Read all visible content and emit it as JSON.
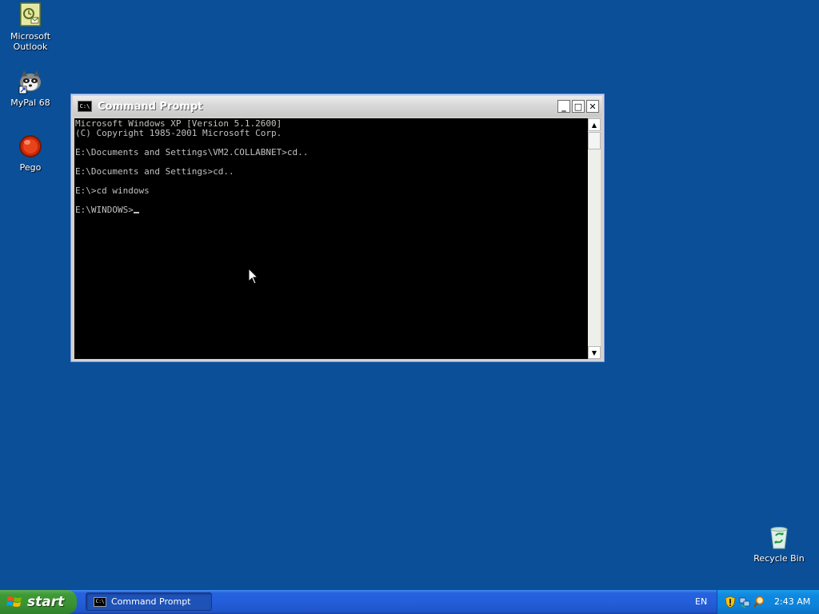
{
  "desktop": {
    "background_color": "#0b4f98",
    "icons": [
      {
        "label_line1": "Microsoft",
        "label_line2": "Outlook",
        "icon": "outlook-icon"
      },
      {
        "label": "MyPal 68",
        "icon": "mypal-icon"
      },
      {
        "label": "Pego",
        "icon": "pego-icon"
      },
      {
        "label": "Recycle Bin",
        "icon": "recycle-bin-icon"
      }
    ]
  },
  "window": {
    "title": "Command Prompt",
    "icon_text": "C:\\",
    "buttons": {
      "minimize": "_",
      "maximize": "□",
      "close": "✕"
    },
    "console_lines": [
      "Microsoft Windows XP [Version 5.1.2600]",
      "(C) Copyright 1985-2001 Microsoft Corp.",
      "",
      "E:\\Documents and Settings\\VM2.COLLABNET>cd..",
      "",
      "E:\\Documents and Settings>cd..",
      "",
      "E:\\>cd windows",
      "",
      "E:\\WINDOWS>"
    ],
    "scroll_up": "▲",
    "scroll_down": "▼"
  },
  "taskbar": {
    "start_label": "start",
    "tasks": [
      {
        "label": "Command Prompt",
        "icon_text": "C:\\"
      }
    ],
    "language": "EN",
    "tray_icons": [
      "shield-icon",
      "network-icon",
      "magnifier-icon"
    ],
    "clock": "2:43 AM"
  }
}
